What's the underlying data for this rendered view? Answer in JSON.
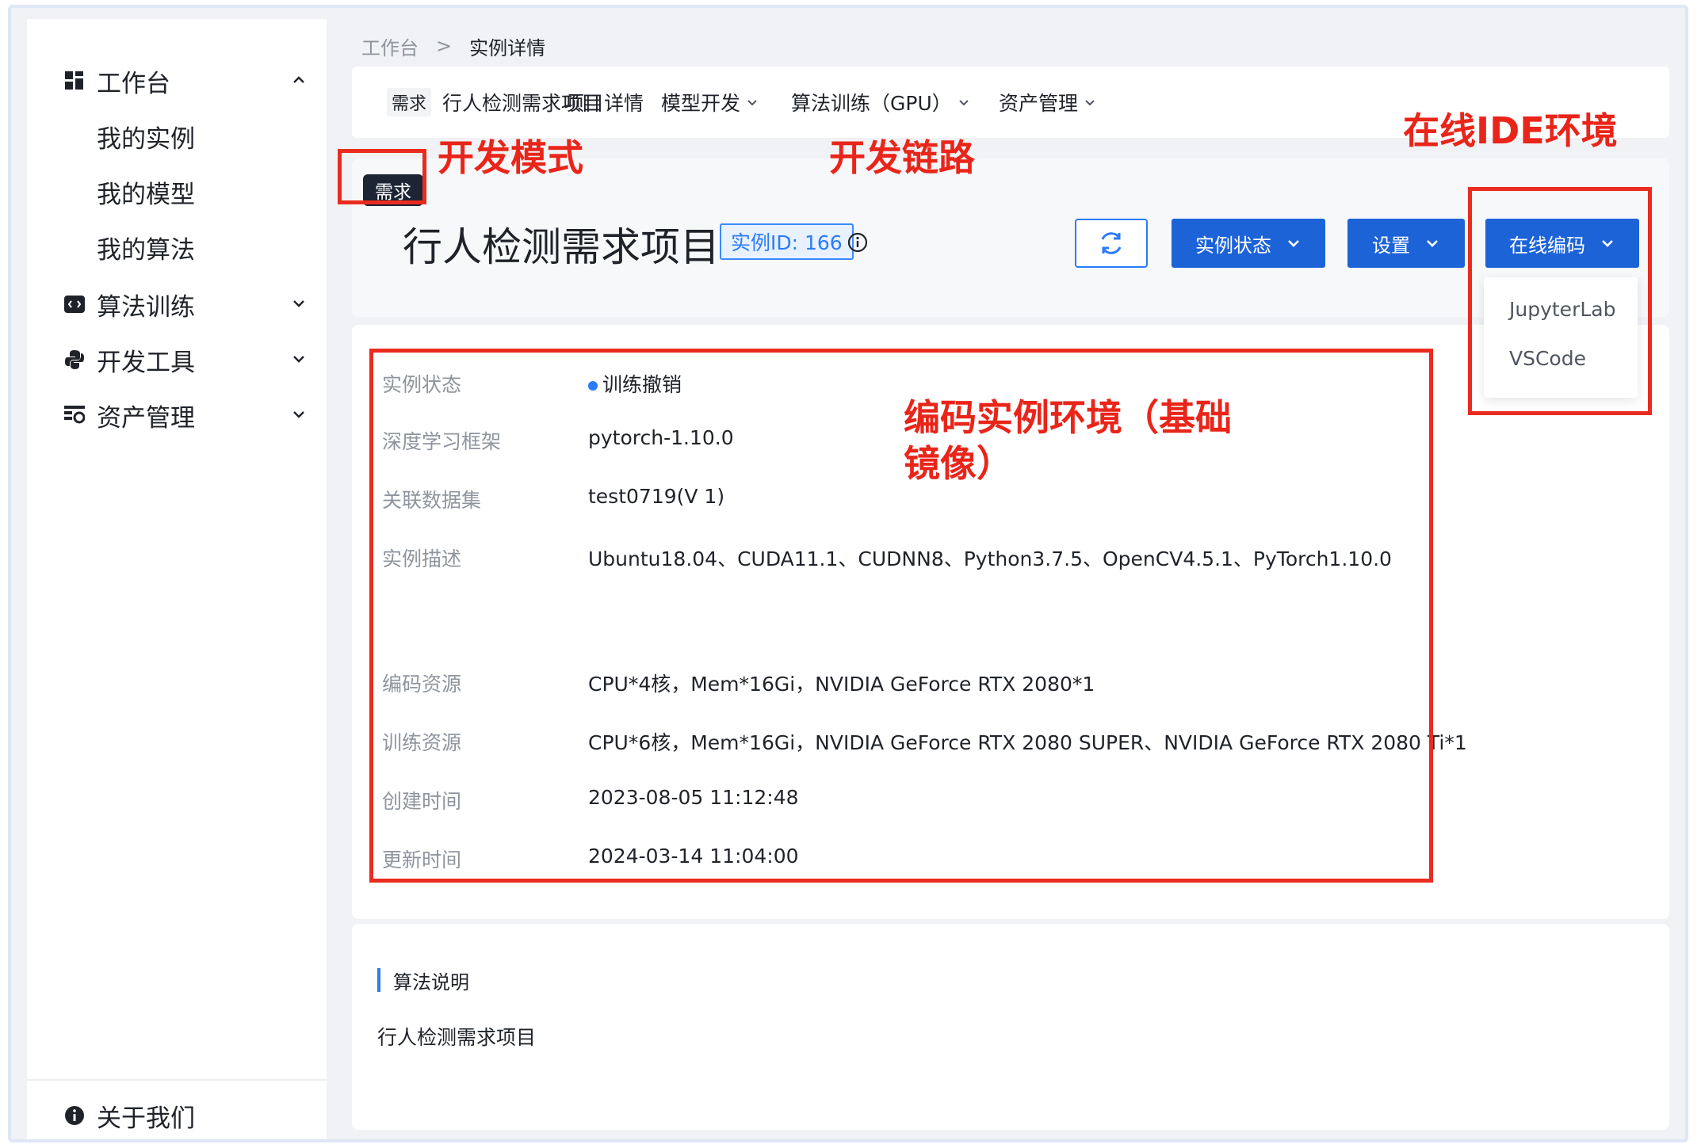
{
  "sidebar": {
    "items": [
      {
        "label": "工作台",
        "icon": "dashboard-icon",
        "expanded": true
      },
      {
        "label": "我的实例"
      },
      {
        "label": "我的模型"
      },
      {
        "label": "我的算法"
      },
      {
        "label": "算法训练",
        "icon": "code-icon"
      },
      {
        "label": "开发工具",
        "icon": "python-icon"
      },
      {
        "label": "资产管理",
        "icon": "asset-icon"
      }
    ],
    "about": "关于我们"
  },
  "breadcrumb": {
    "home": "工作台",
    "separator": ">",
    "current": "实例详情"
  },
  "tabs": {
    "tag": "需求",
    "project": "行人检测需求项目",
    "items": [
      "项目详情",
      "模型开发",
      "算法训练（GPU）",
      "资产管理"
    ]
  },
  "header": {
    "mode_badge": "需求",
    "title": "行人检测需求项目",
    "instance_id": "实例ID: 166",
    "buttons": {
      "status": "实例状态",
      "settings": "设置",
      "online_code": "在线编码"
    },
    "dropdown": [
      "JupyterLab",
      "VSCode"
    ]
  },
  "details": {
    "rows": [
      {
        "label": "实例状态",
        "value": "训练撤销"
      },
      {
        "label": "深度学习框架",
        "value": "pytorch-1.10.0"
      },
      {
        "label": "关联数据集",
        "value": "test0719(V 1)"
      },
      {
        "label": "实例描述",
        "value": "Ubuntu18.04、CUDA11.1、CUDNN8、Python3.7.5、OpenCV4.5.1、PyTorch1.10.0"
      },
      {
        "label": "编码资源",
        "value": "CPU*4核，Mem*16Gi，NVIDIA GeForce RTX 2080*1"
      },
      {
        "label": "训练资源",
        "value": "CPU*6核，Mem*16Gi，NVIDIA GeForce RTX 2080 SUPER、NVIDIA GeForce RTX 2080 Ti*1"
      },
      {
        "label": "创建时间",
        "value": "2023-08-05 11:12:48"
      },
      {
        "label": "更新时间",
        "value": "2024-03-14 11:04:00"
      }
    ]
  },
  "algorithm": {
    "title": "算法说明",
    "description": "行人检测需求项目"
  },
  "annotations": {
    "dev_mode": "开发模式",
    "dev_chain": "开发链路",
    "online_ide": "在线IDE环境",
    "coding_env_line1": "编码实例环境（基础",
    "coding_env_line2": "镜像）"
  },
  "colors": {
    "accent": "#1d63d8",
    "annotation": "#e9251a",
    "status_dot": "#2b7bfa"
  }
}
